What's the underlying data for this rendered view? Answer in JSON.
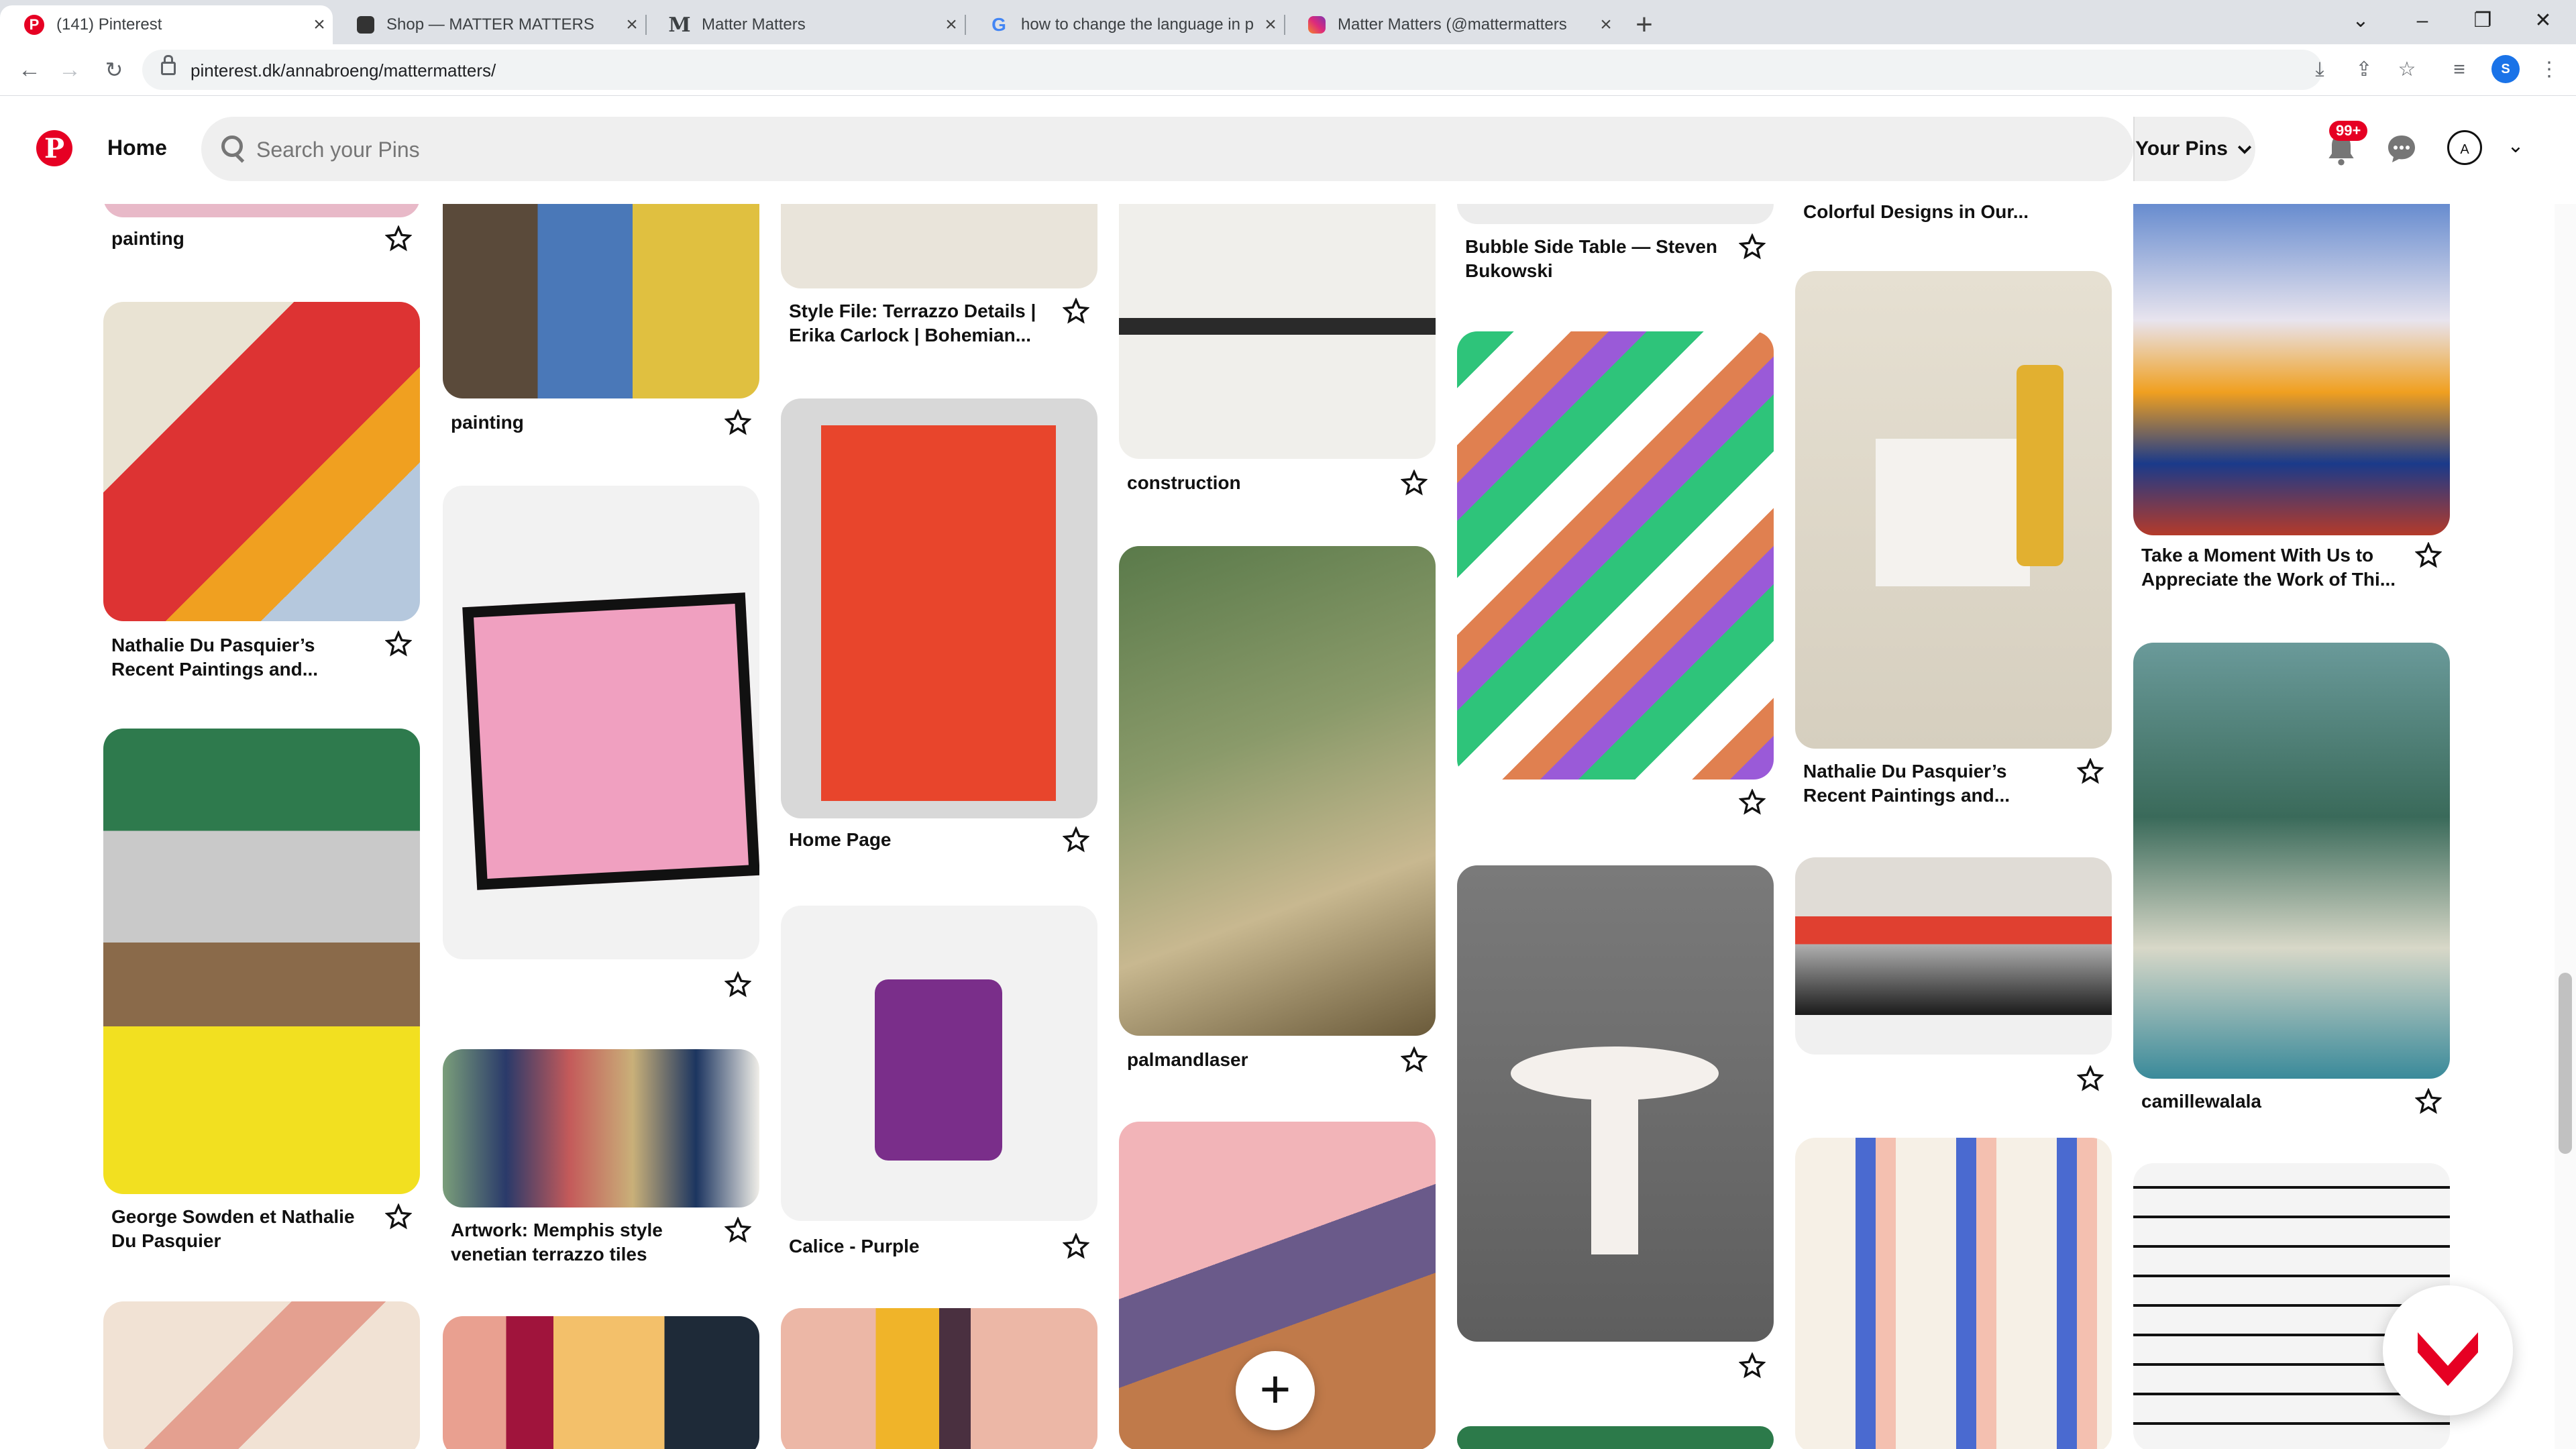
{
  "browser": {
    "tabs": [
      {
        "title": "(141) Pinterest",
        "icon": "pinterest-icon",
        "active": true
      },
      {
        "title": "Shop — MATTER MATTERS",
        "icon": "squarespace-icon"
      },
      {
        "title": "Matter Matters",
        "icon": "medium-icon"
      },
      {
        "title": "how to change the language in p",
        "icon": "google-icon"
      },
      {
        "title": "Matter Matters (@mattermatters",
        "icon": "instagram-icon"
      }
    ],
    "url": "pinterest.dk/annabroeng/mattermatters/",
    "profile_initial": "S"
  },
  "header": {
    "home_label": "Home",
    "search_placeholder": "Search your Pins",
    "your_pins_label": "Your Pins",
    "notification_count": "99+",
    "account_initial": "A"
  },
  "pins": [
    {
      "title": "painting"
    },
    {
      "title": "Nathalie Du Pasquier’s Recent Paintings and..."
    },
    {
      "title": "George Sowden et Nathalie Du Pasquier"
    },
    {
      "title": "painting"
    },
    {
      "title": ""
    },
    {
      "title": "Artwork: Memphis style venetian terrazzo tiles"
    },
    {
      "title": "Style File: Terrazzo Details | Erika Carlock | Bohemian..."
    },
    {
      "title": "Home Page"
    },
    {
      "title": "Calice - Purple"
    },
    {
      "title": "construction"
    },
    {
      "title": "palmandlaser"
    },
    {
      "title": "Bubble Side Table — Steven Bukowski"
    },
    {
      "title": ""
    },
    {
      "title": ""
    },
    {
      "title": "Colorful Designs in Our..."
    },
    {
      "title": "Nathalie Du Pasquier’s Recent Paintings and..."
    },
    {
      "title": ""
    },
    {
      "title": "Take a Moment With Us to Appreciate the Work of Thi..."
    },
    {
      "title": "camillewalala"
    }
  ],
  "colors": {
    "brand": "#e60023",
    "badge": "#e60023"
  }
}
